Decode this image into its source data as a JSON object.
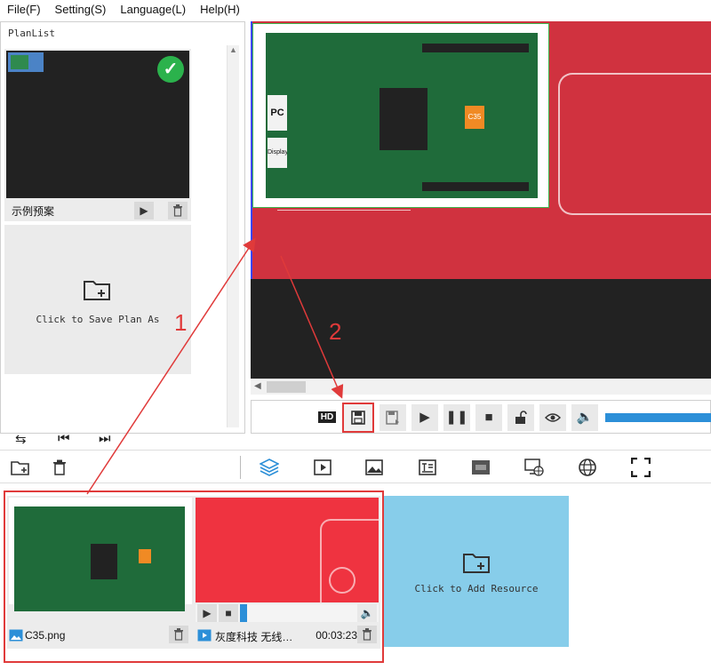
{
  "menu": {
    "file": "File(F)",
    "setting": "Setting(S)",
    "language": "Language(L)",
    "help": "Help(H)"
  },
  "planlist": {
    "title": "PlanList",
    "plan_name": "示例预案",
    "save_label": "Click to Save Plan As"
  },
  "pcb": {
    "label_pc": "PC",
    "label_display": "Display",
    "chip": "C35"
  },
  "playbar": {
    "hd": "HD"
  },
  "resources": {
    "items": [
      {
        "name": "C35.png",
        "type": "image"
      },
      {
        "name": "灰度科技 无线…",
        "type": "video",
        "duration": "00:03:23"
      }
    ],
    "add_label": "Click to Add Resource"
  },
  "annotations": {
    "step1": "1",
    "step2": "2"
  },
  "colors": {
    "accent_red": "#e03a3a",
    "canvas_red": "#d0323f",
    "resource_blue": "#87cdea",
    "check_green": "#2bb24c"
  }
}
